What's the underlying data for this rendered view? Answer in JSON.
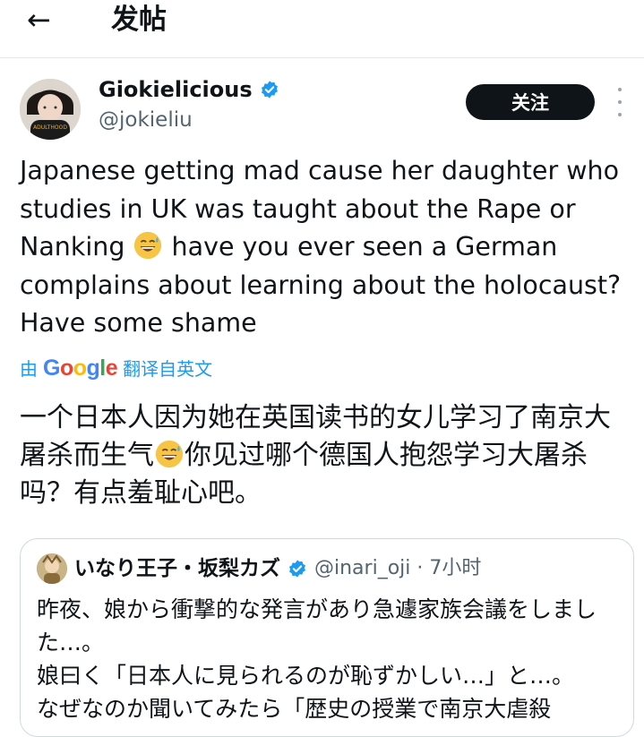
{
  "header": {
    "back_label": "←",
    "title": "发帖"
  },
  "author": {
    "name": "Giokielicious",
    "handle": "@jokieliu",
    "avatar_shirt_text": "ADULTHOOD",
    "verified": true
  },
  "actions": {
    "follow_label": "关注"
  },
  "tweet": {
    "text_before_emoji": "Japanese getting mad cause her daughter who studies in UK was taught about the Rape or Nanking ",
    "text_after_emoji": " have you ever seen a German complains about learning about the holocaust? Have some shame",
    "emoji": "sweat-smile-emoji"
  },
  "translation": {
    "by_prefix": "由",
    "brand": "Google",
    "by_suffix": "翻译自英文",
    "text_before_emoji": "一个日本人因为她在英国读书的女儿学习了南京大屠杀而生气",
    "text_after_emoji": "你见过哪个德国人抱怨学习大屠杀吗？有点羞耻心吧。"
  },
  "quoted": {
    "name": "いなり王子・坂梨カズ",
    "handle_time": "@inari_oji · 7小时",
    "verified": true,
    "lines": [
      "昨夜、娘から衝撃的な発言があり急遽家族会議をしました…。",
      "娘曰く「日本人に見られるのが恥ずかしい…」と…。",
      "なぜなのか聞いてみたら「歴史の授業で南京大虐殺"
    ]
  },
  "colors": {
    "accent": "#1d9bf0",
    "text": "#0f1419",
    "muted": "#536471",
    "border": "#cfd9de"
  }
}
